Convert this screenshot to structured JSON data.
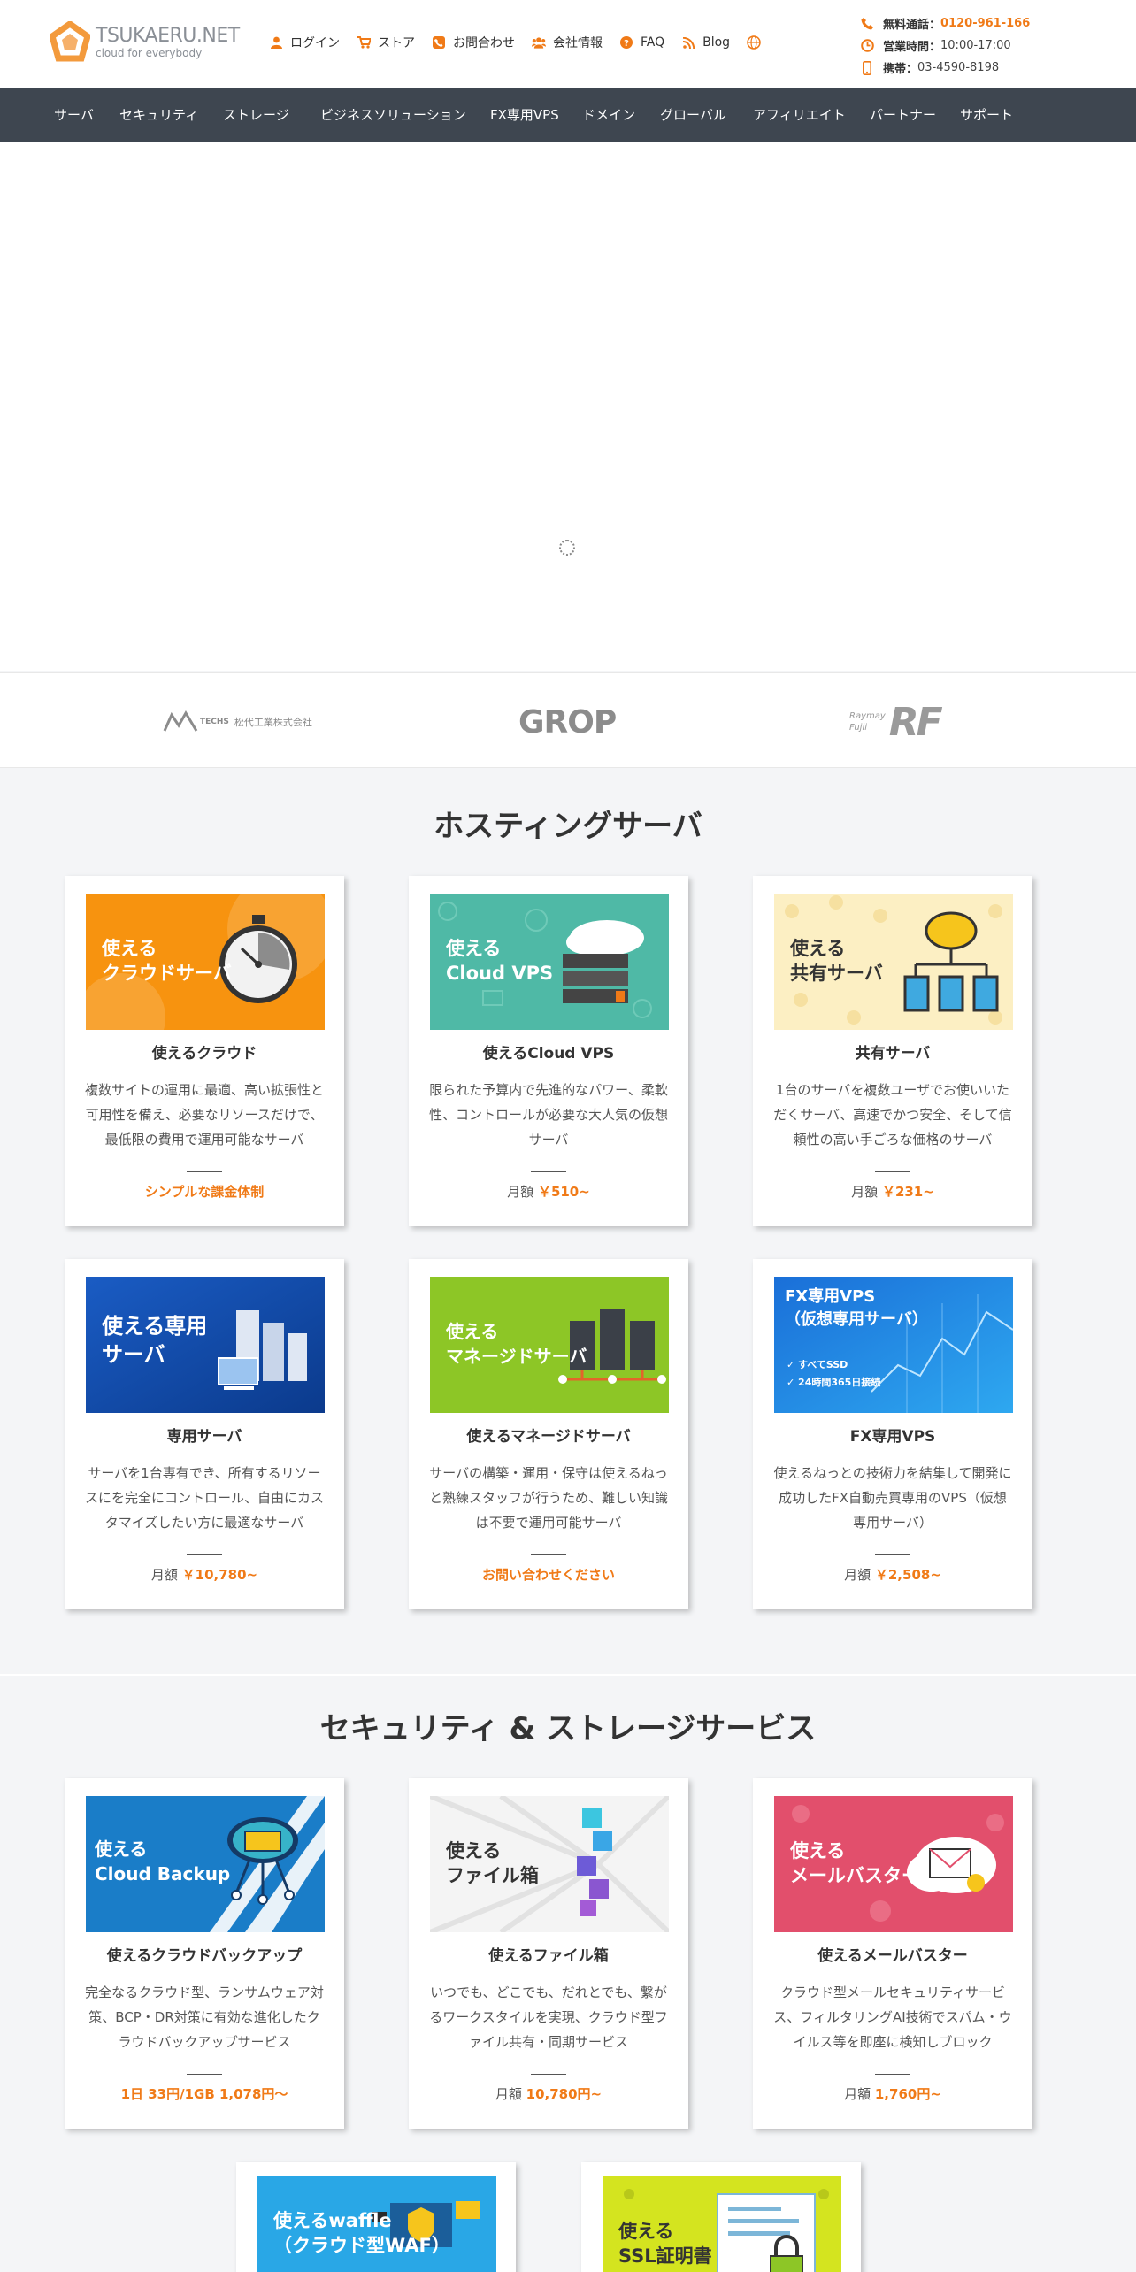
{
  "logo": {
    "name": "TSUKAERU.NET",
    "tagline": "cloud for everybody"
  },
  "topnav": [
    {
      "label": "ログイン",
      "icon": "user-icon"
    },
    {
      "label": "ストア",
      "icon": "cart-icon"
    },
    {
      "label": "お問合わせ",
      "icon": "phone-icon"
    },
    {
      "label": "会社情報",
      "icon": "users-icon"
    },
    {
      "label": "FAQ",
      "icon": "question-icon"
    },
    {
      "label": "Blog",
      "icon": "rss-icon"
    },
    {
      "label": "",
      "icon": "globe-icon"
    }
  ],
  "contact": {
    "free_label": "無料通話：",
    "free_value": "0120-961-166",
    "hours_label": "営業時間：",
    "hours_value": "10:00-17:00",
    "mobile_label": "携帯：",
    "mobile_value": "03-4590-8198"
  },
  "mainnav": [
    "サーバ",
    "セキュリティ",
    "ストレージ",
    "ビジネスソリューション",
    "FX専用VPS",
    "ドメイン",
    "グローバル",
    "アフィリエイト",
    "パートナー",
    "サポート"
  ],
  "partners": {
    "p1_main": "松代工業株式会社",
    "p1_sub": "TECHS",
    "p2": "GROP",
    "p3_small1": "Raymay",
    "p3_small2": "Fujii",
    "p3_main": "RF"
  },
  "hosting": {
    "title": "ホスティングサーバ",
    "cards": [
      {
        "thumb": "使える\nクラウドサーバ",
        "title": "使えるクラウド",
        "desc": "複数サイトの運用に最適、高い拡張性と可用性を備え、必要なリソースだけで、最低限の費用で運用可能なサーバ",
        "price_text": "シンプルな課金体制",
        "price_prefix": "",
        "price_amount": ""
      },
      {
        "thumb": "使える\nCloud VPS",
        "title": "使えるCloud VPS",
        "desc": "限られた予算内で先進的なパワー、柔軟性、コントロールが必要な大人気の仮想サーバ",
        "price_text": "",
        "price_prefix": "月額 ",
        "price_amount": "￥510~"
      },
      {
        "thumb": "使える\n共有サーバ",
        "title": "共有サーバ",
        "desc": "1台のサーバを複数ユーザでお使いいただくサーバ、高速でかつ安全、そして信頼性の高い手ごろな価格のサーバ",
        "price_text": "",
        "price_prefix": "月額 ",
        "price_amount": "￥231~"
      },
      {
        "thumb": "使える専用\nサーバ",
        "title": "専用サーバ",
        "desc": "サーバを1台専有でき、所有するリソースにを完全にコントロール、自由にカスタマイズしたい方に最適なサーバ",
        "price_text": "",
        "price_prefix": "月額 ",
        "price_amount": "￥10,780~"
      },
      {
        "thumb": "使える\nマネージドサーバ",
        "title": "使えるマネージドサーバ",
        "desc": "サーバの構築・運用・保守は使えるねっと熟練スタッフが行うため、難しい知識は不要で運用可能サーバ",
        "price_text": "お問い合わせください",
        "price_prefix": "",
        "price_amount": ""
      },
      {
        "thumb": "FX専用VPS\n（仮想専用サーバ）",
        "thumb_sub1": "✓ すべてSSD",
        "thumb_sub2": "✓ 24時間365日接続",
        "title": "FX専用VPS",
        "desc": "使えるねっとの技術力を結集して開発に成功したFX自動売買専用のVPS（仮想専用サーバ）",
        "price_text": "",
        "price_prefix": "月額 ",
        "price_amount": "￥2,508~"
      }
    ]
  },
  "security": {
    "title": "セキュリティ & ストレージサービス",
    "cards": [
      {
        "thumb": "使える\nCloud Backup",
        "title": "使えるクラウドバックアップ",
        "desc": "完全なるクラウド型、ランサムウェア対策、BCP・DR対策に有効な進化したクラウドバックアップサービス",
        "price_text": "1日 33円/1GB 1,078円～",
        "price_prefix": "",
        "price_amount": ""
      },
      {
        "thumb": "使える\nファイル箱",
        "title": "使えるファイル箱",
        "desc": "いつでも、どこでも、だれとでも、繋がるワークスタイルを実現、クラウド型ファイル共有・同期サービス",
        "price_text": "",
        "price_prefix": "月額 ",
        "price_amount": "10,780円~"
      },
      {
        "thumb": "使える\nメールバスター",
        "title": "使えるメールバスター",
        "desc": "クラウド型メールセキュリティサービス、フィルタリングAI技術でスパム・ウイルス等を即座に検知しブロック",
        "price_text": "",
        "price_prefix": "月額 ",
        "price_amount": "1,760円~"
      },
      {
        "thumb": "使えるwaffle\n（クラウド型WAF）",
        "title": "",
        "desc": "",
        "price_text": "",
        "price_prefix": "",
        "price_amount": ""
      },
      {
        "thumb": "使える\nSSL証明書",
        "title": "",
        "desc": "",
        "price_text": "",
        "price_prefix": "",
        "price_amount": ""
      }
    ]
  },
  "colors": {
    "accent": "#f07a17",
    "nav_bg": "#3e4650",
    "page_bg": "#f4f5f7"
  }
}
